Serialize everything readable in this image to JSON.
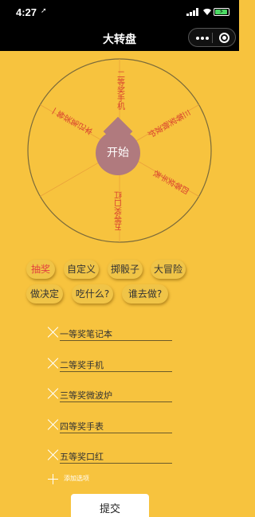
{
  "status": {
    "time": "4:27",
    "arrow": "➚"
  },
  "nav": {
    "title": "大转盘"
  },
  "wheel": {
    "start_label": "开始",
    "colors": {
      "fill": "#F7C33E",
      "border": "#7a6a3a",
      "divider": "#EAA23A",
      "text": "#D9402F",
      "hub": "#B07A7E"
    },
    "segments": [
      "一等奖笔记本",
      "二等奖手机",
      "三等奖微波炉",
      "四等奖手表",
      "五等奖口红",
      ""
    ]
  },
  "modes": {
    "row1": [
      "抽奖",
      "自定义",
      "掷骰子",
      "大冒险"
    ],
    "row2": [
      "做决定",
      "吃什么?",
      "谁去做?"
    ]
  },
  "prizes": [
    "一等奖笔记本",
    "二等奖手机",
    "三等奖微波炉",
    "四等奖手表",
    "五等奖口红"
  ],
  "add_label": "添加选项",
  "submit_label": "提交",
  "colors": {
    "background": "#F7C33E",
    "active_mode": "#E23F3F"
  }
}
